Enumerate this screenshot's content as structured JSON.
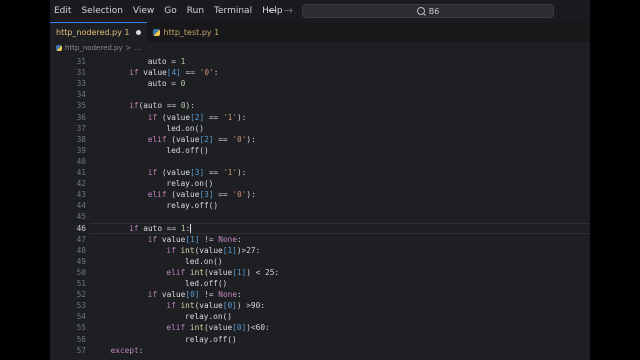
{
  "menu": [
    "Edit",
    "Selection",
    "View",
    "Go",
    "Run",
    "Terminal",
    "Help"
  ],
  "nav": {
    "back": "←",
    "forward": "→"
  },
  "search": {
    "text": "B6"
  },
  "tabs": [
    {
      "label": "http_nodered.py 1",
      "active": true,
      "dirty": true
    },
    {
      "label": "http_test.py 1",
      "active": false,
      "dirty": false
    }
  ],
  "breadcrumb": {
    "file": "http_nodered.py",
    "sep": ">",
    "more": "..."
  },
  "editor": {
    "current_line": 46,
    "lines": [
      {
        "n": 31,
        "i": 3,
        "t": [
          [
            "auto ",
            "vr"
          ],
          [
            "= ",
            "nm"
          ],
          [
            "1",
            "bi"
          ]
        ]
      },
      {
        "n": 31,
        "i": 2,
        "t": [
          [
            "if ",
            "kw"
          ],
          [
            "value",
            "vr"
          ],
          [
            "[4] ",
            "idx"
          ],
          [
            "== ",
            "nm"
          ],
          [
            "'0'",
            "st"
          ],
          [
            ":",
            "nm"
          ]
        ]
      },
      {
        "n": 33,
        "i": 3,
        "t": [
          [
            "auto ",
            "vr"
          ],
          [
            "= ",
            "nm"
          ],
          [
            "0",
            "bi"
          ]
        ]
      },
      {
        "n": 34,
        "i": 0,
        "t": []
      },
      {
        "n": 35,
        "i": 2,
        "t": [
          [
            "if",
            "kw"
          ],
          [
            "(auto ",
            "vr"
          ],
          [
            "== ",
            "nm"
          ],
          [
            "0",
            "bi"
          ],
          [
            "):",
            "nm"
          ]
        ]
      },
      {
        "n": 36,
        "i": 3,
        "t": [
          [
            "if ",
            "kw"
          ],
          [
            "(value",
            "vr"
          ],
          [
            "[2] ",
            "idx"
          ],
          [
            "== ",
            "nm"
          ],
          [
            "'1'",
            "st"
          ],
          [
            "):",
            "nm"
          ]
        ]
      },
      {
        "n": 37,
        "i": 4,
        "t": [
          [
            "led.on()",
            "vr"
          ]
        ]
      },
      {
        "n": 38,
        "i": 3,
        "t": [
          [
            "elif ",
            "kw"
          ],
          [
            "(value",
            "vr"
          ],
          [
            "[2] ",
            "idx"
          ],
          [
            "== ",
            "nm"
          ],
          [
            "'0'",
            "st"
          ],
          [
            "):",
            "nm"
          ]
        ]
      },
      {
        "n": 39,
        "i": 4,
        "t": [
          [
            "led.off()",
            "vr"
          ]
        ]
      },
      {
        "n": 40,
        "i": 0,
        "t": []
      },
      {
        "n": 41,
        "i": 3,
        "t": [
          [
            "if ",
            "kw"
          ],
          [
            "(value",
            "vr"
          ],
          [
            "[3] ",
            "idx"
          ],
          [
            "== ",
            "nm"
          ],
          [
            "'1'",
            "st"
          ],
          [
            "):",
            "nm"
          ]
        ]
      },
      {
        "n": 42,
        "i": 4,
        "t": [
          [
            "relay.on()",
            "vr"
          ]
        ]
      },
      {
        "n": 43,
        "i": 3,
        "t": [
          [
            "elif ",
            "kw"
          ],
          [
            "(value",
            "vr"
          ],
          [
            "[3] ",
            "idx"
          ],
          [
            "== ",
            "nm"
          ],
          [
            "'0'",
            "st"
          ],
          [
            "):",
            "nm"
          ]
        ]
      },
      {
        "n": 44,
        "i": 4,
        "t": [
          [
            "relay.off()",
            "vr"
          ]
        ]
      },
      {
        "n": 45,
        "i": 0,
        "t": []
      },
      {
        "n": 46,
        "i": 2,
        "t": [
          [
            "if ",
            "kw"
          ],
          [
            "auto ",
            "vr"
          ],
          [
            "== ",
            "nm"
          ],
          [
            "1",
            "bi"
          ],
          [
            ":",
            "nm"
          ]
        ]
      },
      {
        "n": 47,
        "i": 3,
        "t": [
          [
            "if ",
            "kw"
          ],
          [
            "value",
            "vr"
          ],
          [
            "[1] ",
            "idx"
          ],
          [
            "!= ",
            "nm"
          ],
          [
            "None",
            "kw"
          ],
          [
            ":",
            "nm"
          ]
        ]
      },
      {
        "n": 48,
        "i": 4,
        "t": [
          [
            "if ",
            "kw"
          ],
          [
            "int",
            "fn"
          ],
          [
            "(value",
            "vr"
          ],
          [
            "[1]",
            "idx"
          ],
          [
            ")>27:",
            "nm"
          ]
        ]
      },
      {
        "n": 49,
        "i": 5,
        "t": [
          [
            "led.on()",
            "vr"
          ]
        ]
      },
      {
        "n": 50,
        "i": 4,
        "t": [
          [
            "elif ",
            "kw"
          ],
          [
            "int",
            "fn"
          ],
          [
            "(value",
            "vr"
          ],
          [
            "[1]",
            "idx"
          ],
          [
            ") < 25:",
            "nm"
          ]
        ]
      },
      {
        "n": 51,
        "i": 5,
        "t": [
          [
            "led.off()",
            "vr"
          ]
        ]
      },
      {
        "n": 52,
        "i": 3,
        "t": [
          [
            "if ",
            "kw"
          ],
          [
            "value",
            "vr"
          ],
          [
            "[0] ",
            "idx"
          ],
          [
            "!= ",
            "nm"
          ],
          [
            "None",
            "kw"
          ],
          [
            ":",
            "nm"
          ]
        ]
      },
      {
        "n": 53,
        "i": 4,
        "t": [
          [
            "if ",
            "kw"
          ],
          [
            "int",
            "fn"
          ],
          [
            "(value",
            "vr"
          ],
          [
            "[0]",
            "idx"
          ],
          [
            ") >90:",
            "nm"
          ]
        ]
      },
      {
        "n": 54,
        "i": 5,
        "t": [
          [
            "relay.on()",
            "vr"
          ]
        ]
      },
      {
        "n": 55,
        "i": 4,
        "t": [
          [
            "elif ",
            "kw"
          ],
          [
            "int",
            "fn"
          ],
          [
            "(value",
            "vr"
          ],
          [
            "[0]",
            "idx"
          ],
          [
            ")<60:",
            "nm"
          ]
        ]
      },
      {
        "n": 56,
        "i": 5,
        "t": [
          [
            "relay.off()",
            "vr"
          ]
        ]
      },
      {
        "n": 57,
        "i": 1,
        "t": [
          [
            "except",
            "kw"
          ],
          [
            ":",
            "nm"
          ]
        ]
      }
    ]
  }
}
